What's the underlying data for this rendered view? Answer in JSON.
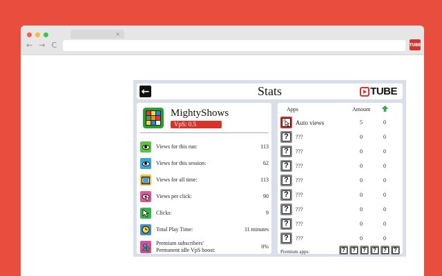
{
  "browser": {
    "tab_close": "×",
    "nav": {
      "back": "←",
      "forward": "→",
      "reload": "C"
    },
    "extension_label": "TUBE",
    "colors": {
      "background": "#e84d3d",
      "dot_red": "#f25c55",
      "dot_yellow": "#f8b93b",
      "dot_green": "#36c64b"
    }
  },
  "header": {
    "back_icon": "arrow-left-icon",
    "title": "Stats",
    "logo_text": "TUBE"
  },
  "profile": {
    "name": "MightyShows",
    "vps": "VpS: 0.5"
  },
  "stats": [
    {
      "icon": "eye-icon",
      "label": "Views for this run:",
      "value": "113",
      "color": "#5dc33c"
    },
    {
      "icon": "eye-icon",
      "label": "Views for this session:",
      "value": "62",
      "color": "#3aa6d8"
    },
    {
      "icon": "film-icon",
      "label": "Views for all time:",
      "value": "113",
      "color": "#f2c12e"
    },
    {
      "icon": "cursor-eye-icon",
      "label": "Views per click:",
      "value": "90",
      "color": "#e2559a"
    },
    {
      "icon": "cursor-icon",
      "label": "Clicks:",
      "value": "9",
      "color": "#37b54a"
    },
    {
      "icon": "clock-icon",
      "label": "Total Play Time:",
      "value": "11 minutes",
      "color": "#3f8fd1"
    },
    {
      "icon": "subscribers-icon",
      "label": "Premium subscribers' Permanent idle VpS boost:",
      "label_line1": "Premium subscribers'",
      "label_line2": "Permanent idle VpS boost:",
      "value": "0%",
      "color": "#d64f9a"
    }
  ],
  "apps": {
    "headers": {
      "name": "Apps",
      "amount": "Amount",
      "upgrade_icon": "upgrade-arrow-icon"
    },
    "rows": [
      {
        "icon": "auto-click-icon",
        "name": "Auto views",
        "amount": "5",
        "upgrades": "0"
      },
      {
        "icon": "question-icon",
        "name": "???",
        "amount": "0",
        "upgrades": "0"
      },
      {
        "icon": "question-icon",
        "name": "???",
        "amount": "0",
        "upgrades": "0"
      },
      {
        "icon": "question-icon",
        "name": "???",
        "amount": "0",
        "upgrades": "0"
      },
      {
        "icon": "question-icon",
        "name": "???",
        "amount": "0",
        "upgrades": "0"
      },
      {
        "icon": "question-icon",
        "name": "???",
        "amount": "0",
        "upgrades": "0"
      },
      {
        "icon": "question-icon",
        "name": "???",
        "amount": "0",
        "upgrades": "0"
      },
      {
        "icon": "question-icon",
        "name": "???",
        "amount": "0",
        "upgrades": "0"
      },
      {
        "icon": "question-icon",
        "name": "???",
        "amount": "0",
        "upgrades": "0"
      }
    ],
    "premium_label": "Premium apps:",
    "premium_icons": [
      "?",
      "?",
      "?",
      "?",
      "?",
      "?"
    ],
    "question_mark": "?"
  }
}
